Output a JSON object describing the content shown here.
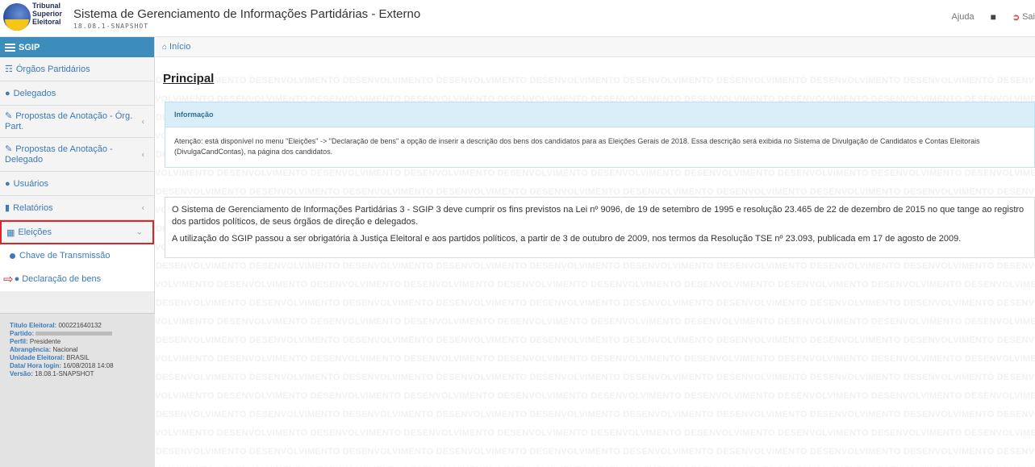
{
  "header": {
    "logo_lines": [
      "Tribunal",
      "Superior",
      "Eleitoral"
    ],
    "title": "Sistema de Gerenciamento de Informações Partidárias - Externo",
    "version": "18.08.1-SNAPSHOT",
    "help_label": "Ajuda",
    "user_icon": "user-icon",
    "logout_label": "Sai"
  },
  "sidebar": {
    "title": "SGIP",
    "items": [
      {
        "label": "Órgãos Partidários",
        "icon": "sitemap-icon",
        "chevron": false
      },
      {
        "label": "Delegados",
        "icon": "users-icon",
        "chevron": false
      },
      {
        "label": "Propostas de Anotação - Órg. Part.",
        "icon": "edit-icon",
        "chevron": true
      },
      {
        "label": "Propostas de Anotação - Delegado",
        "icon": "edit-icon",
        "chevron": true
      },
      {
        "label": "Usuários",
        "icon": "users-icon",
        "chevron": false
      },
      {
        "label": "Relatórios",
        "icon": "bar-chart-icon",
        "chevron": true
      },
      {
        "label": "Eleições",
        "icon": "calendar-icon",
        "chevron": true,
        "active": true
      }
    ],
    "subitems": [
      {
        "label": "Chave de Transmissão",
        "icon": "circle-icon"
      },
      {
        "label": "Declaração de bens",
        "icon": "users-icon",
        "highlighted_by_arrow": true
      }
    ]
  },
  "user_info": {
    "titulo_label": "Título Eleitoral:",
    "titulo_value": "000221640132",
    "partido_label": "Partido:",
    "perfil_label": "Perfil:",
    "perfil_value": "Presidente",
    "abrangencia_label": "Abrangência:",
    "abrangencia_value": "Nacional",
    "unidade_label": "Unidade Eleitoral:",
    "unidade_value": "BRASIL",
    "data_label": "Data/ Hora login:",
    "data_value": "16/08/2018 14:08",
    "versao_label": "Versão:",
    "versao_value": "18.08.1-SNAPSHOT"
  },
  "breadcrumb": {
    "home_label": "Início"
  },
  "main": {
    "page_title": "Principal",
    "watermark_text": "DESENVOLVIMENTO",
    "info": {
      "heading": "Informação",
      "text": "Atenção: está disponível no menu \"Eleições\" -> \"Declaração de bens\" a opção de inserir a descrição dos bens dos candidatos para as Eleições Gerais de 2018. Essa descrição será exibida no Sistema de Divulgação de Candidatos e Contas Eleitorais (DivulgaCandContas), na página dos candidatos."
    },
    "paragraphs": [
      "O Sistema de Gerenciamento de Informações Partidárias 3 - SGIP 3 deve cumprir os fins previstos na Lei nº 9096, de 19 de setembro de 1995 e resolução 23.465 de 22 de dezembro de 2015 no que tange ao registro dos partidos políticos, de seus órgãos de direção e delegados.",
      "A utilização do SGIP passou a ser obrigatória à Justiça Eleitoral e aos partidos políticos, a partir de 3 de outubro de 2009, nos termos da Resolução TSE nº 23.093, publicada em 17 de agosto de 2009."
    ]
  }
}
